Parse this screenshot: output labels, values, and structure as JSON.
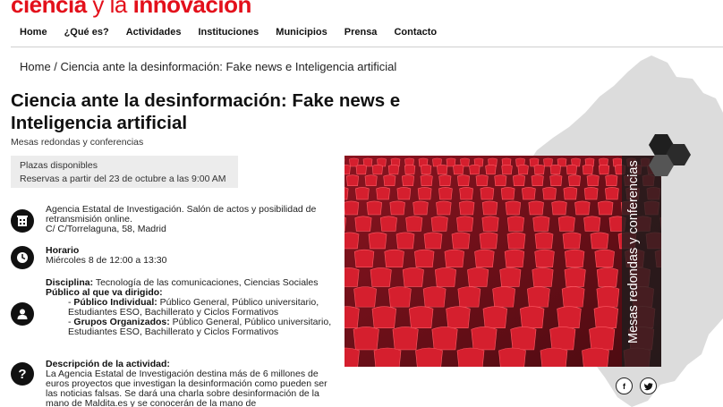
{
  "header": {
    "logo_part1": "ciencia",
    "logo_part2": " y la ",
    "logo_part3": "innovación"
  },
  "nav": {
    "items": [
      "Home",
      "¿Qué es?",
      "Actividades",
      "Instituciones",
      "Municipios",
      "Prensa",
      "Contacto"
    ]
  },
  "breadcrumb": {
    "home": "Home",
    "separator": " / ",
    "current": "Ciencia ante la desinformación: Fake news e Inteligencia artificial"
  },
  "event": {
    "title": "Ciencia ante la desinformación: Fake news e Inteligencia artificial",
    "subtitle": "Mesas redondas y conferencias",
    "plazas_label": "Plazas disponibles",
    "reservas": "Reservas a partir del 23 de octubre a las 9:00 AM",
    "location_line1": "Agencia Estatal de Investigación. Salón de actos y posibilidad de retransmisión online.",
    "location_line2": "C/ C/Torrelaguna, 58, Madrid",
    "horario_label": "Horario",
    "horario_value": "Miércoles 8 de 12:00 a 13:30",
    "disciplina_label": "Disciplina:",
    "disciplina_value": " Tecnología de las comunicaciones, Ciencias Sociales",
    "publico_label": "Público al que va dirigido:",
    "publico_individual_label": "Público Individual:",
    "publico_individual_value": " Público General, Público universitario, Estudiantes ESO, Bachillerato y Ciclos Formativos",
    "grupos_label": "Grupos Organizados:",
    "grupos_value": " Público General, Público universitario, Estudiantes ESO, Bachillerato y Ciclos Formativos",
    "descripcion_label": "Descripción de la actividad:",
    "descripcion_value": "La Agencia Estatal de Investigación destina más de 6 millones de euros proyectos que investigan la desinformación como pueden ser las noticias falsas. Se dará una charla sobre desinformación de la mano de Maldita.es y se conocerán de la mano de",
    "image_label": "Mesas redondas y conferencias"
  },
  "icons": {
    "location": "building-icon",
    "horario": "clock-icon",
    "publico": "person-icon",
    "descripcion": "question-icon",
    "facebook": "facebook-icon",
    "twitter": "twitter-icon"
  },
  "colors": {
    "brand_red": "#e3101b",
    "seat_red": "#d51f2e",
    "hex_dark": "#1f1f1f",
    "map_gray": "#dcdcdc"
  }
}
